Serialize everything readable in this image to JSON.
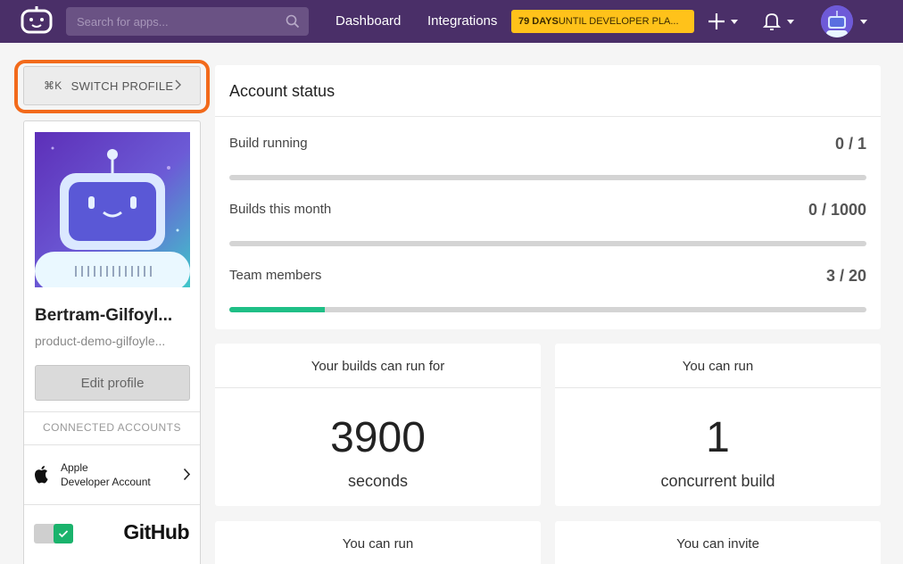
{
  "topbar": {
    "search_placeholder": "Search for apps...",
    "nav": [
      "Dashboard",
      "Integrations"
    ],
    "trial_bold": "79 DAYS",
    "trial_rest": " UNTIL DEVELOPER PLA...",
    "colors": {
      "bar": "#4a2f68",
      "trial": "#ffc21a"
    }
  },
  "sidebar": {
    "switch_shortcut": "⌘K",
    "switch_label": "SWITCH PROFILE",
    "profile_name": "Bertram-Gilfoyl...",
    "profile_handle": "product-demo-gilfoyle...",
    "edit_label": "Edit profile",
    "connected_label": "CONNECTED ACCOUNTS",
    "apple_line1": "Apple",
    "apple_line2": "Developer Account",
    "github_label": "GitHub"
  },
  "status": {
    "title": "Account status",
    "metrics": [
      {
        "label": "Build running",
        "value": "0 / 1",
        "fraction": 0
      },
      {
        "label": "Builds this month",
        "value": "0 / 1000",
        "fraction": 0
      },
      {
        "label": "Team members",
        "value": "3 / 20",
        "fraction": 0.15
      }
    ],
    "accent": "#1fbf86"
  },
  "stats": [
    {
      "heading": "Your builds can run for",
      "number": "3900",
      "unit": "seconds"
    },
    {
      "heading": "You can run",
      "number": "1",
      "unit": "concurrent build"
    },
    {
      "heading": "You can run"
    },
    {
      "heading": "You can invite"
    }
  ],
  "highlight_color": "#f26a1b"
}
